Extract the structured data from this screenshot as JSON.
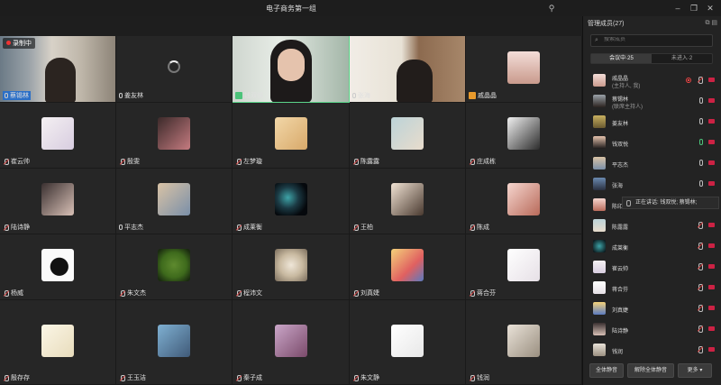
{
  "window": {
    "title": "电子商务第一组"
  },
  "recording": "录制中",
  "tiles_row1": [
    {
      "name": "蔡锡林"
    },
    {
      "name": "姜友林"
    },
    {
      "name": "钱双悦"
    },
    {
      "name": "张海"
    },
    {
      "name": "戚晶晶"
    }
  ],
  "tiles_row2": [
    {
      "name": "崔云帅"
    },
    {
      "name": "殷雯"
    },
    {
      "name": "左梦璇"
    },
    {
      "name": "陈露露"
    },
    {
      "name": "庄成栋"
    }
  ],
  "tiles_row3": [
    {
      "name": "陆诗静"
    },
    {
      "name": "平志杰"
    },
    {
      "name": "成莱衡"
    },
    {
      "name": "王柏"
    },
    {
      "name": "陈成"
    }
  ],
  "tiles_row4": [
    {
      "name": "杨威"
    },
    {
      "name": "朱文杰"
    },
    {
      "name": "程沛文"
    },
    {
      "name": "刘真婕"
    },
    {
      "name": "蒋合芬"
    }
  ],
  "tiles_row5": [
    {
      "name": "殷存存"
    },
    {
      "name": "王玉洁"
    },
    {
      "name": "秦子成"
    },
    {
      "name": "朱文静"
    },
    {
      "name": "钱润"
    }
  ],
  "panel": {
    "title": "管理成员(27)",
    "search_placeholder": "搜索成员",
    "tab_in_meeting": "会议中·25",
    "tab_not_joined": "未进入·2",
    "speaking_tooltip": "正在讲话: 钱双悦; 蔡锡林;",
    "members": [
      {
        "name": "戚晶晶",
        "sub": "(主持人, 我)"
      },
      {
        "name": "蔡锡林",
        "sub": "(联席主持人)"
      },
      {
        "name": "姜友林",
        "sub": ""
      },
      {
        "name": "钱双悦",
        "sub": ""
      },
      {
        "name": "平志杰",
        "sub": ""
      },
      {
        "name": "张海",
        "sub": ""
      },
      {
        "name": "陈印",
        "sub": ""
      },
      {
        "name": "陈露露",
        "sub": ""
      },
      {
        "name": "成莱衡",
        "sub": ""
      },
      {
        "name": "崔云帅",
        "sub": ""
      },
      {
        "name": "蒋合芬",
        "sub": ""
      },
      {
        "name": "刘真婕",
        "sub": ""
      },
      {
        "name": "陆诗静",
        "sub": ""
      },
      {
        "name": "钱润",
        "sub": ""
      }
    ],
    "btn_mute_all": "全体静音",
    "btn_unmute_all": "解除全体静音",
    "btn_more": "更多 ▾"
  }
}
